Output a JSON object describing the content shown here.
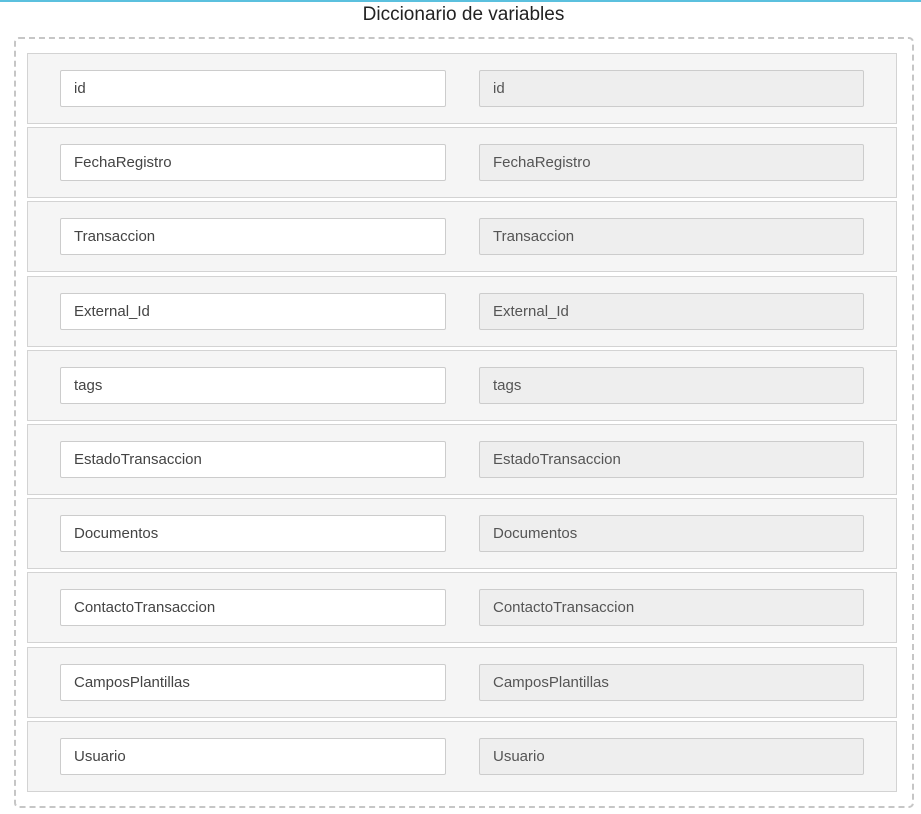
{
  "title": "Diccionario de variables",
  "colors": {
    "accent_top_line": "#5bc0de",
    "row_background": "#f5f5f5",
    "readonly_field": "#eeeeee"
  },
  "variables": [
    {
      "name": "id",
      "mapped": "id"
    },
    {
      "name": "FechaRegistro",
      "mapped": "FechaRegistro"
    },
    {
      "name": "Transaccion",
      "mapped": "Transaccion"
    },
    {
      "name": "External_Id",
      "mapped": "External_Id"
    },
    {
      "name": "tags",
      "mapped": "tags"
    },
    {
      "name": "EstadoTransaccion",
      "mapped": "EstadoTransaccion"
    },
    {
      "name": "Documentos",
      "mapped": "Documentos"
    },
    {
      "name": "ContactoTransaccion",
      "mapped": "ContactoTransaccion"
    },
    {
      "name": "CamposPlantillas",
      "mapped": "CamposPlantillas"
    },
    {
      "name": "Usuario",
      "mapped": "Usuario"
    }
  ]
}
